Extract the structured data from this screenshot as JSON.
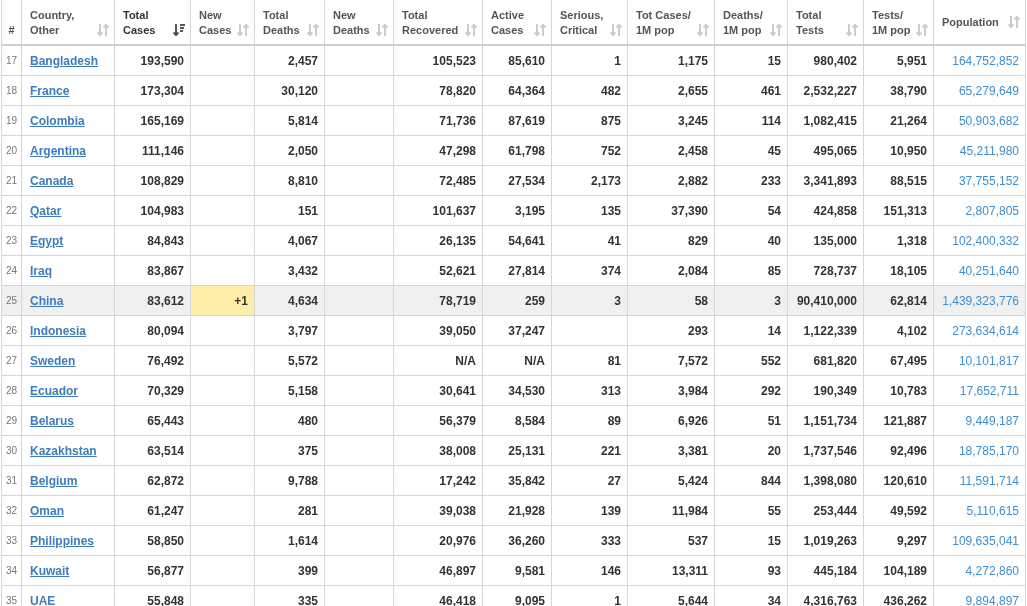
{
  "table": {
    "columns": [
      {
        "label": "#"
      },
      {
        "label": "Country,\nOther",
        "sorted": false
      },
      {
        "label": "Total\nCases",
        "sorted": true
      },
      {
        "label": "New\nCases",
        "sorted": false
      },
      {
        "label": "Total\nDeaths",
        "sorted": false
      },
      {
        "label": "New\nDeaths",
        "sorted": false
      },
      {
        "label": "Total\nRecovered",
        "sorted": false
      },
      {
        "label": "Active\nCases",
        "sorted": false
      },
      {
        "label": "Serious,\nCritical",
        "sorted": false
      },
      {
        "label": "Tot Cases/\n1M pop",
        "sorted": false
      },
      {
        "label": "Deaths/\n1M pop",
        "sorted": false
      },
      {
        "label": "Total\nTests",
        "sorted": false
      },
      {
        "label": "Tests/\n1M pop",
        "sorted": false
      },
      {
        "label": "Population",
        "sorted": false
      }
    ],
    "rows": [
      {
        "rank": "17",
        "country": "Bangladesh",
        "highlighted": false,
        "total_cases": "193,590",
        "total_deaths": "2,457",
        "total_recovered": "105,523",
        "active_cases": "85,610",
        "serious_critical": "1",
        "cases_per_1m": "1,175",
        "deaths_per_1m": "15",
        "total_tests": "980,402",
        "tests_per_1m": "5,951",
        "population": "164,752,852"
      },
      {
        "rank": "18",
        "country": "France",
        "highlighted": false,
        "total_cases": "173,304",
        "total_deaths": "30,120",
        "total_recovered": "78,820",
        "active_cases": "64,364",
        "serious_critical": "482",
        "cases_per_1m": "2,655",
        "deaths_per_1m": "461",
        "total_tests": "2,532,227",
        "tests_per_1m": "38,790",
        "population": "65,279,649"
      },
      {
        "rank": "19",
        "country": "Colombia",
        "highlighted": false,
        "total_cases": "165,169",
        "total_deaths": "5,814",
        "total_recovered": "71,736",
        "active_cases": "87,619",
        "serious_critical": "875",
        "cases_per_1m": "3,245",
        "deaths_per_1m": "114",
        "total_tests": "1,082,415",
        "tests_per_1m": "21,264",
        "population": "50,903,682"
      },
      {
        "rank": "20",
        "country": "Argentina",
        "highlighted": false,
        "total_cases": "111,146",
        "total_deaths": "2,050",
        "total_recovered": "47,298",
        "active_cases": "61,798",
        "serious_critical": "752",
        "cases_per_1m": "2,458",
        "deaths_per_1m": "45",
        "total_tests": "495,065",
        "tests_per_1m": "10,950",
        "population": "45,211,980"
      },
      {
        "rank": "21",
        "country": "Canada",
        "highlighted": false,
        "total_cases": "108,829",
        "total_deaths": "8,810",
        "total_recovered": "72,485",
        "active_cases": "27,534",
        "serious_critical": "2,173",
        "cases_per_1m": "2,882",
        "deaths_per_1m": "233",
        "total_tests": "3,341,893",
        "tests_per_1m": "88,515",
        "population": "37,755,152"
      },
      {
        "rank": "22",
        "country": "Qatar",
        "highlighted": false,
        "total_cases": "104,983",
        "total_deaths": "151",
        "total_recovered": "101,637",
        "active_cases": "3,195",
        "serious_critical": "135",
        "cases_per_1m": "37,390",
        "deaths_per_1m": "54",
        "total_tests": "424,858",
        "tests_per_1m": "151,313",
        "population": "2,807,805"
      },
      {
        "rank": "23",
        "country": "Egypt",
        "highlighted": false,
        "total_cases": "84,843",
        "total_deaths": "4,067",
        "total_recovered": "26,135",
        "active_cases": "54,641",
        "serious_critical": "41",
        "cases_per_1m": "829",
        "deaths_per_1m": "40",
        "total_tests": "135,000",
        "tests_per_1m": "1,318",
        "population": "102,400,332"
      },
      {
        "rank": "24",
        "country": "Iraq",
        "highlighted": false,
        "total_cases": "83,867",
        "total_deaths": "3,432",
        "total_recovered": "52,621",
        "active_cases": "27,814",
        "serious_critical": "374",
        "cases_per_1m": "2,084",
        "deaths_per_1m": "85",
        "total_tests": "728,737",
        "tests_per_1m": "18,105",
        "population": "40,251,640"
      },
      {
        "rank": "25",
        "country": "China",
        "highlighted": true,
        "total_cases": "83,612",
        "new_cases": "+1",
        "total_deaths": "4,634",
        "total_recovered": "78,719",
        "active_cases": "259",
        "serious_critical": "3",
        "cases_per_1m": "58",
        "deaths_per_1m": "3",
        "total_tests": "90,410,000",
        "tests_per_1m": "62,814",
        "population": "1,439,323,776"
      },
      {
        "rank": "26",
        "country": "Indonesia",
        "highlighted": false,
        "total_cases": "80,094",
        "total_deaths": "3,797",
        "total_recovered": "39,050",
        "active_cases": "37,247",
        "cases_per_1m": "293",
        "deaths_per_1m": "14",
        "total_tests": "1,122,339",
        "tests_per_1m": "4,102",
        "population": "273,634,614"
      },
      {
        "rank": "27",
        "country": "Sweden",
        "highlighted": false,
        "total_cases": "76,492",
        "total_deaths": "5,572",
        "total_recovered": "N/A",
        "active_cases": "N/A",
        "serious_critical": "81",
        "cases_per_1m": "7,572",
        "deaths_per_1m": "552",
        "total_tests": "681,820",
        "tests_per_1m": "67,495",
        "population": "10,101,817"
      },
      {
        "rank": "28",
        "country": "Ecuador",
        "highlighted": false,
        "total_cases": "70,329",
        "total_deaths": "5,158",
        "total_recovered": "30,641",
        "active_cases": "34,530",
        "serious_critical": "313",
        "cases_per_1m": "3,984",
        "deaths_per_1m": "292",
        "total_tests": "190,349",
        "tests_per_1m": "10,783",
        "population": "17,652,711"
      },
      {
        "rank": "29",
        "country": "Belarus",
        "highlighted": false,
        "total_cases": "65,443",
        "total_deaths": "480",
        "total_recovered": "56,379",
        "active_cases": "8,584",
        "serious_critical": "89",
        "cases_per_1m": "6,926",
        "deaths_per_1m": "51",
        "total_tests": "1,151,734",
        "tests_per_1m": "121,887",
        "population": "9,449,187"
      },
      {
        "rank": "30",
        "country": "Kazakhstan",
        "highlighted": false,
        "total_cases": "63,514",
        "total_deaths": "375",
        "total_recovered": "38,008",
        "active_cases": "25,131",
        "serious_critical": "221",
        "cases_per_1m": "3,381",
        "deaths_per_1m": "20",
        "total_tests": "1,737,546",
        "tests_per_1m": "92,496",
        "population": "18,785,170"
      },
      {
        "rank": "31",
        "country": "Belgium",
        "highlighted": false,
        "total_cases": "62,872",
        "total_deaths": "9,788",
        "total_recovered": "17,242",
        "active_cases": "35,842",
        "serious_critical": "27",
        "cases_per_1m": "5,424",
        "deaths_per_1m": "844",
        "total_tests": "1,398,080",
        "tests_per_1m": "120,610",
        "population": "11,591,714"
      },
      {
        "rank": "32",
        "country": "Oman",
        "highlighted": false,
        "total_cases": "61,247",
        "total_deaths": "281",
        "total_recovered": "39,038",
        "active_cases": "21,928",
        "serious_critical": "139",
        "cases_per_1m": "11,984",
        "deaths_per_1m": "55",
        "total_tests": "253,444",
        "tests_per_1m": "49,592",
        "population": "5,110,615"
      },
      {
        "rank": "33",
        "country": "Philippines",
        "highlighted": false,
        "total_cases": "58,850",
        "total_deaths": "1,614",
        "total_recovered": "20,976",
        "active_cases": "36,260",
        "serious_critical": "333",
        "cases_per_1m": "537",
        "deaths_per_1m": "15",
        "total_tests": "1,019,263",
        "tests_per_1m": "9,297",
        "population": "109,635,041"
      },
      {
        "rank": "34",
        "country": "Kuwait",
        "highlighted": false,
        "total_cases": "56,877",
        "total_deaths": "399",
        "total_recovered": "46,897",
        "active_cases": "9,581",
        "serious_critical": "146",
        "cases_per_1m": "13,311",
        "deaths_per_1m": "93",
        "total_tests": "445,184",
        "tests_per_1m": "104,189",
        "population": "4,272,860"
      },
      {
        "rank": "35",
        "country": "UAE",
        "highlighted": false,
        "total_cases": "55,848",
        "total_deaths": "335",
        "total_recovered": "46,418",
        "active_cases": "9,095",
        "serious_critical": "1",
        "cases_per_1m": "5,644",
        "deaths_per_1m": "34",
        "total_tests": "4,316,763",
        "tests_per_1m": "436,262",
        "population": "9,894,897"
      }
    ]
  }
}
